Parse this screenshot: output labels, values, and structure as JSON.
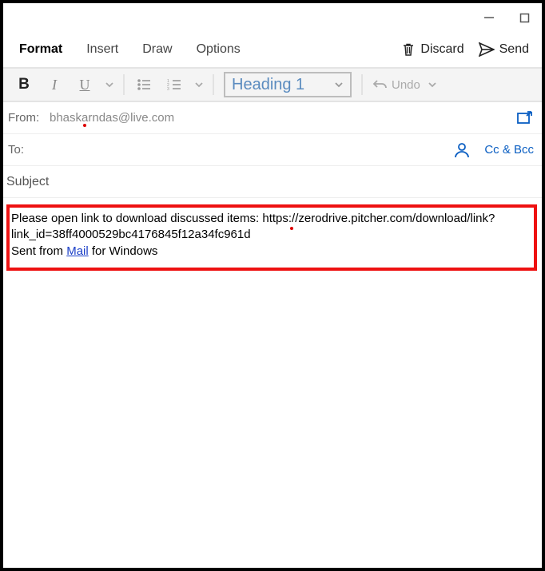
{
  "window": {
    "minimize": "minimize",
    "maximize": "maximize"
  },
  "tabs": {
    "format": "Format",
    "insert": "Insert",
    "draw": "Draw",
    "options": "Options"
  },
  "actions": {
    "discard": "Discard",
    "send": "Send"
  },
  "toolbar": {
    "bold": "B",
    "italic": "I",
    "underline": "U",
    "heading_selected": "Heading 1",
    "undo": "Undo"
  },
  "fields": {
    "from_label": "From:",
    "from_value": "bhaskarndas@live.com",
    "to_label": "To:",
    "to_value": "",
    "ccbcc": "Cc & Bcc",
    "subject_placeholder": "Subject",
    "subject_value": ""
  },
  "body": {
    "line1_prefix": "Please open link to download discussed items: https",
    "line1_colon": ":",
    "line1_rest": "//zerodrive.pitcher.com/download/link?",
    "line2": "link_id=38ff4000529bc4176845f12a34fc961d",
    "sig_prefix": "Sent from ",
    "sig_link": "Mail",
    "sig_suffix": " for Windows"
  }
}
